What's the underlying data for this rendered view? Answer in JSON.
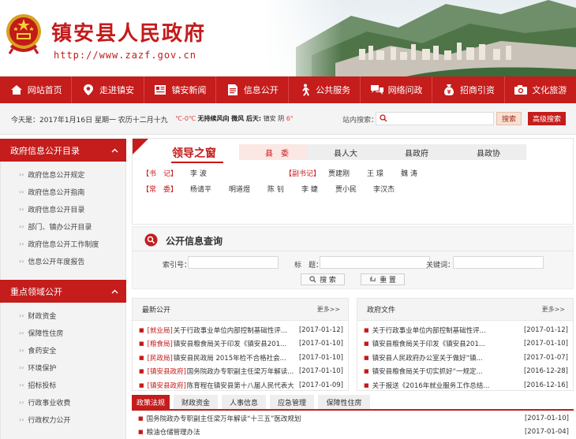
{
  "header": {
    "title": "镇安县人民政府",
    "url": "http://www.zazf.gov.cn"
  },
  "nav": [
    {
      "label": "网站首页",
      "icon": "home-icon"
    },
    {
      "label": "走进镇安",
      "icon": "location-pin-icon"
    },
    {
      "label": "镇安新闻",
      "icon": "newspaper-icon"
    },
    {
      "label": "信息公开",
      "icon": "document-icon"
    },
    {
      "label": "公共服务",
      "icon": "person-walking-icon"
    },
    {
      "label": "网络问政",
      "icon": "chat-bubbles-icon"
    },
    {
      "label": "招商引资",
      "icon": "money-bag-icon"
    },
    {
      "label": "文化旅游",
      "icon": "camera-icon"
    }
  ],
  "infobar": {
    "date": "今天是：2017年1月16日  星期一  农历十二月十九",
    "weather": {
      "temp": "℃-0℃",
      "desc": "无持续风向 微风",
      "tomorrow": "后天:",
      "place": "镇安",
      "cond": "阴",
      "temp2": "6°"
    },
    "search_label": "站内搜索：",
    "search_placeholder": "",
    "search_button": "搜索",
    "advanced_button": "高级搜索"
  },
  "sidebar": {
    "gov_info": {
      "title": "政府信息公开目录",
      "items": [
        "政府信息公开规定",
        "政府信息公开指南",
        "政府信息公开目录",
        "部门、镇办公开目录",
        "政府信息公开工作制度",
        "信息公开年度报告"
      ]
    },
    "key_areas": {
      "title": "重点领域公开",
      "items": [
        "财政资金",
        "保障性住房",
        "食药安全",
        "环境保护",
        "招标投标",
        "行政事业收费",
        "行政权力公开"
      ]
    }
  },
  "leaders": {
    "title": "领导之窗",
    "tabs": [
      "县　委",
      "县人大",
      "县政府",
      "县政协"
    ],
    "shuji_label": "【书　记】",
    "shuji": "李 波",
    "fushuji_label": "【副书记】",
    "fushuji": [
      "贾建刚",
      "王 璟",
      "魏 涛"
    ],
    "changwei_label": "【常　委】",
    "changwei": [
      "杨请平",
      "明道煜",
      "陈 钊",
      "李 婕",
      "贾小民",
      "李汉杰"
    ]
  },
  "query": {
    "title": "公开信息查询",
    "index_label": "索引号：",
    "title_label": "标　题：",
    "keyword_label": "关键词：",
    "search_button": "搜 索",
    "reset_button": "重 置"
  },
  "latest": {
    "title": "最新公开",
    "more": "更多>>",
    "items": [
      {
        "tag": "[就业局]",
        "text": "关于行政事业单位内部控制基础性评...",
        "date": "[2017-01-12]"
      },
      {
        "tag": "[粮食局]",
        "text": "镇安县粮食局关于印发《镇安县201...",
        "date": "[2017-01-10]"
      },
      {
        "tag": "[民政局]",
        "text": "镇安县民政局 2015年检不合格社会...",
        "date": "[2017-01-10]"
      },
      {
        "tag": "[镇安县政府]",
        "text": "国务院政办专职副主任梁万年解读...",
        "date": "[2017-01-10]"
      },
      {
        "tag": "[镇安县政府]",
        "text": "陈育程在镇安县第十八届人民代表大...",
        "date": "[2017-01-09]"
      }
    ]
  },
  "gov_docs": {
    "title": "政府文件",
    "more": "更多>>",
    "items": [
      {
        "text": "关于行政事业单位内部控制基础性评...",
        "date": "[2017-01-12]"
      },
      {
        "text": "镇安县粮食局关于印发《镇安县201...",
        "date": "[2017-01-10]"
      },
      {
        "text": "镇安县人民政府办公室关于做好“镇...",
        "date": "[2017-01-07]"
      },
      {
        "text": "镇安县粮食局关于切实抓好“一规定...",
        "date": "[2016-12-28]"
      },
      {
        "text": "关于报送《2016年就业服务工作总结...",
        "date": "[2016-12-16]"
      }
    ]
  },
  "bottom": {
    "tabs": [
      "政策法规",
      "财政资金",
      "人事信息",
      "应急管理",
      "保障性住房"
    ],
    "items": [
      {
        "text": "国务院政办专职副主任梁万年解读“十三五”医改规划",
        "date": "[2017-01-10]"
      },
      {
        "text": "粮油仓储管理办法",
        "date": "[2017-01-04]"
      }
    ]
  }
}
